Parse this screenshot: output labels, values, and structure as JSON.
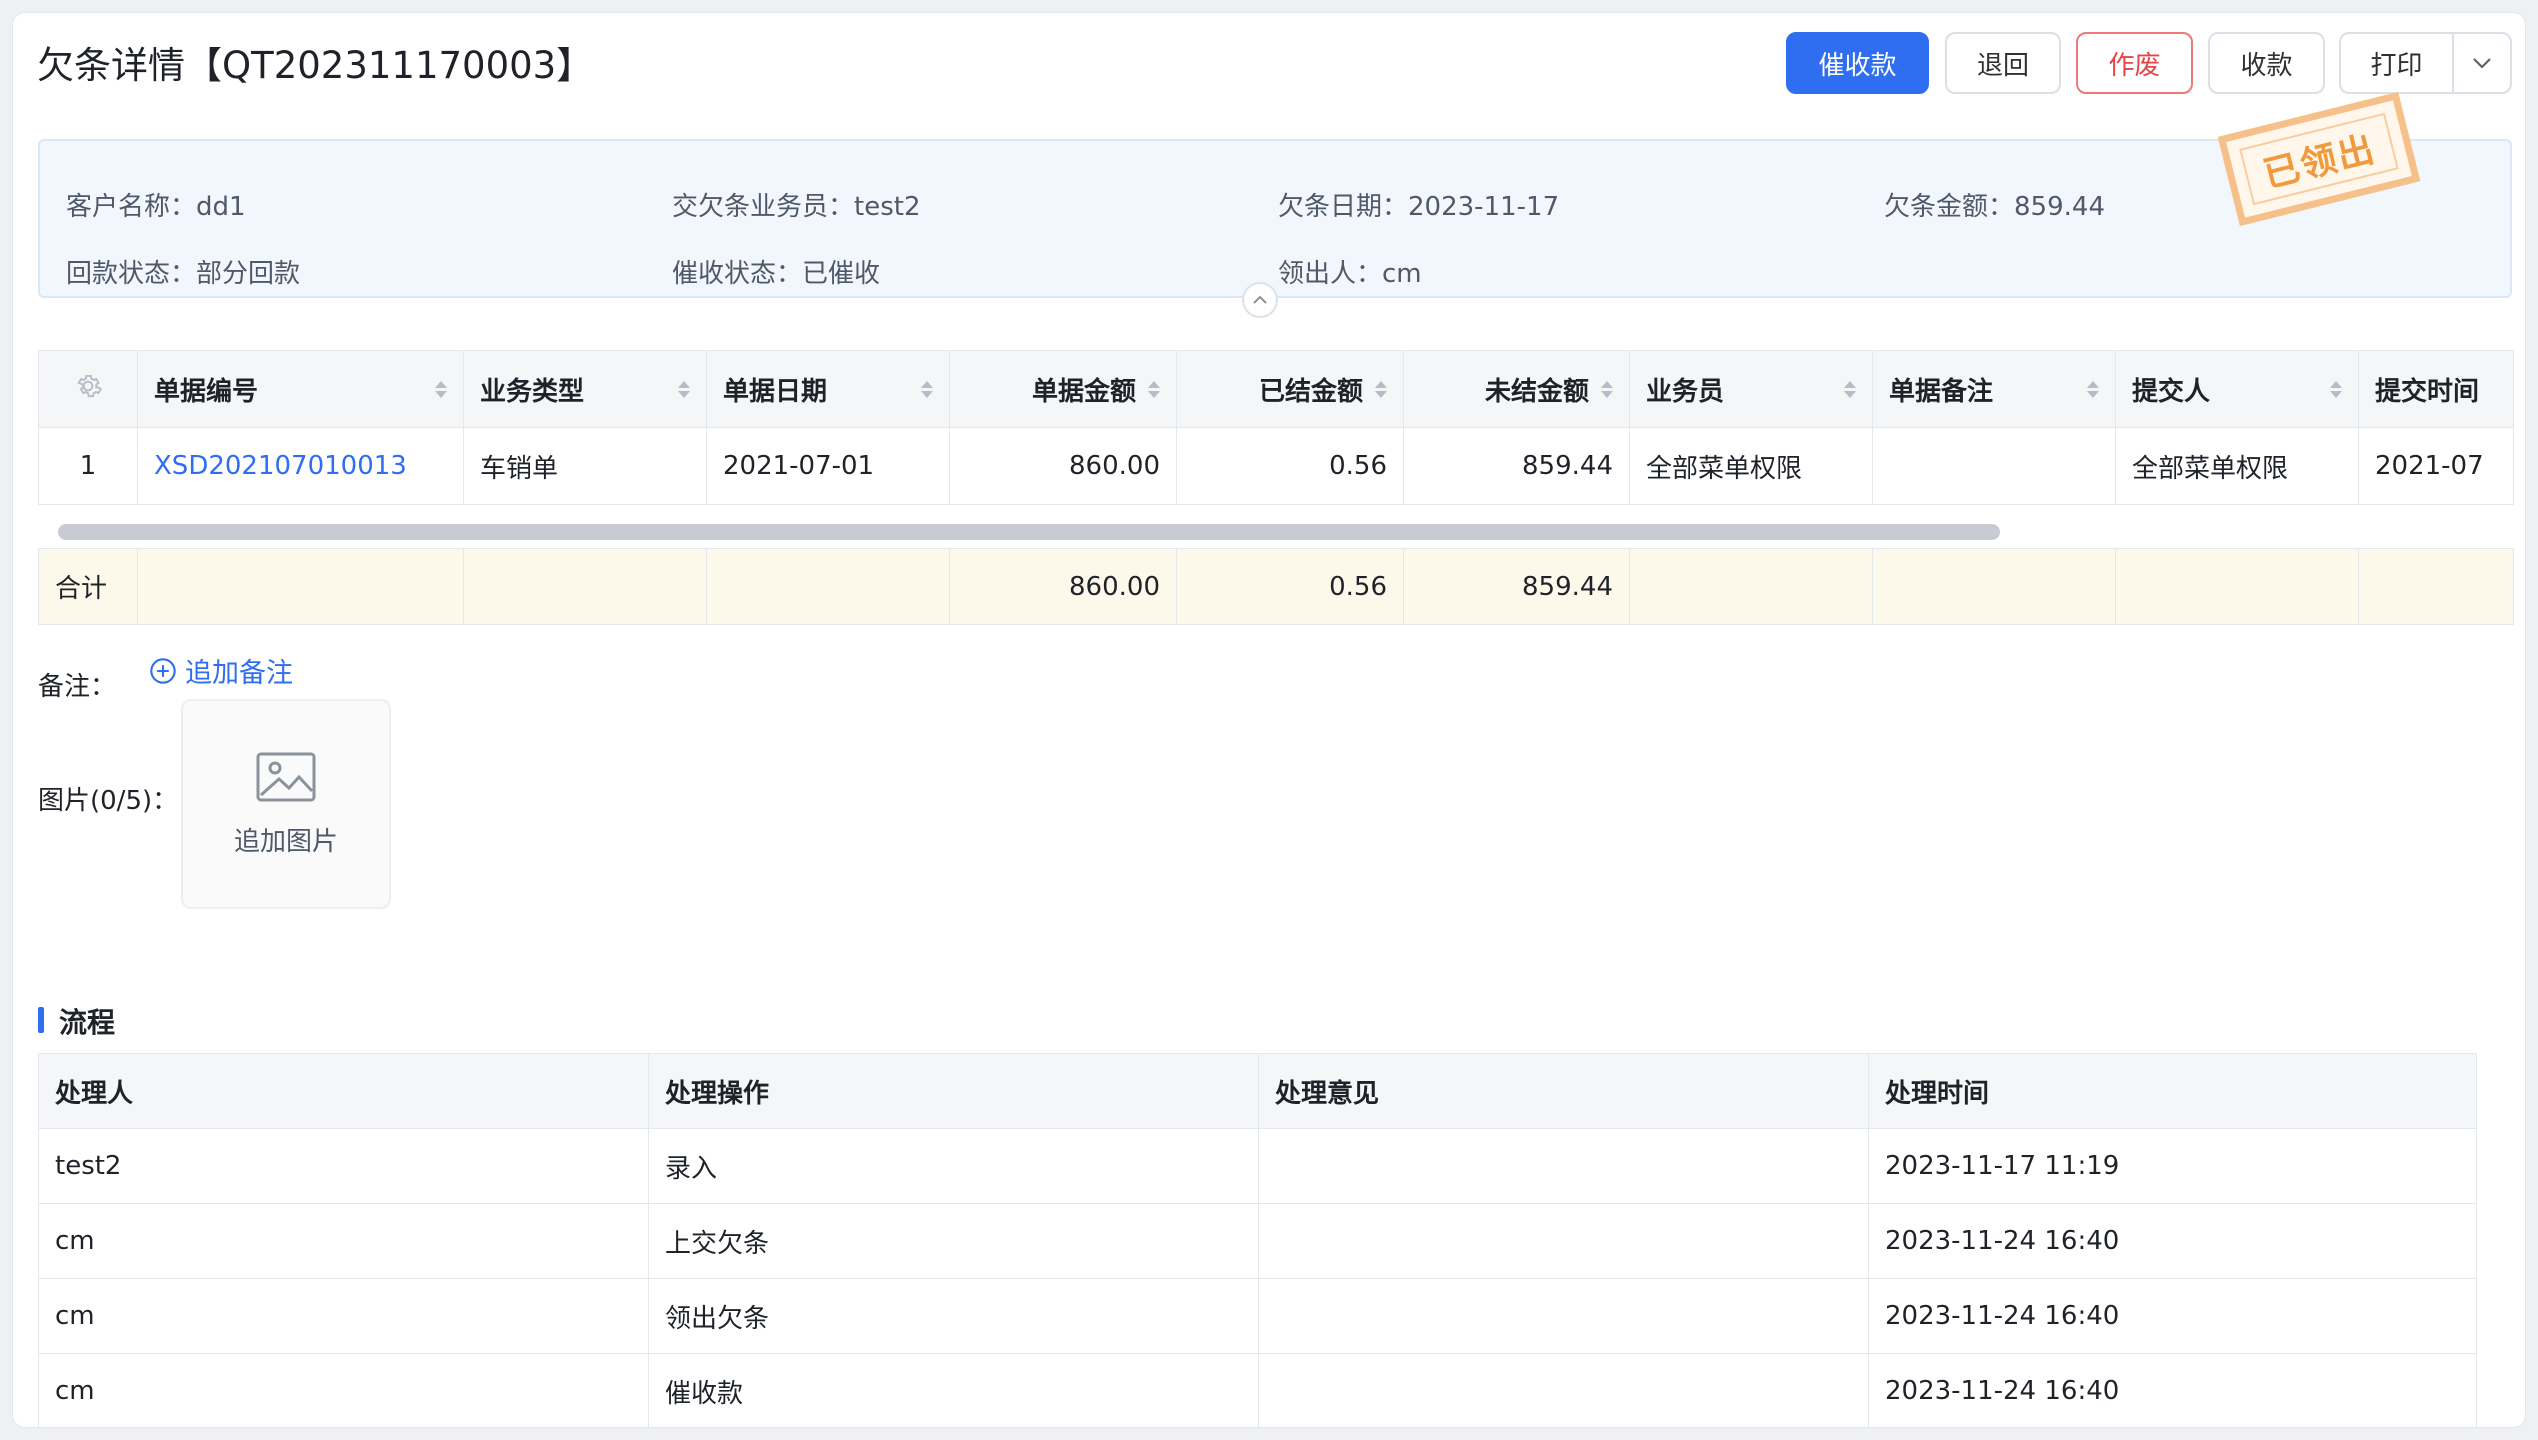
{
  "header": {
    "title": "欠条详情【QT202311170003】",
    "buttons": {
      "urge": "催收款",
      "return": "退回",
      "void": "作废",
      "collect": "收款",
      "print": "打印"
    }
  },
  "info": {
    "customer_label": "客户名称：",
    "customer_value": "dd1",
    "salesman_label": "交欠条业务员：",
    "salesman_value": "test2",
    "date_label": "欠条日期：",
    "date_value": "2023-11-17",
    "amount_label": "欠条金额：",
    "amount_value": "859.44",
    "repay_label": "回款状态：",
    "repay_value": "部分回款",
    "urge_label": "催收状态：",
    "urge_value": "已催收",
    "taker_label": "领出人：",
    "taker_value": "cm",
    "stamp": "已领出"
  },
  "docs_table": {
    "headers": [
      "单据编号",
      "业务类型",
      "单据日期",
      "单据金额",
      "已结金额",
      "未结金额",
      "业务员",
      "单据备注",
      "提交人",
      "提交时间"
    ],
    "rows": [
      [
        "1",
        "XSD202107010013",
        "车销单",
        "2021-07-01",
        "860.00",
        "0.56",
        "859.44",
        "全部菜单权限",
        "",
        "全部菜单权限",
        "2021-07"
      ]
    ],
    "summary": {
      "label": "合计",
      "doc_amount": "860.00",
      "settled": "0.56",
      "unsettled": "859.44"
    }
  },
  "remark": {
    "label": "备注：",
    "add_label": "追加备注"
  },
  "images": {
    "label": "图片(0/5)：",
    "add_label": "追加图片"
  },
  "flow": {
    "title": "流程",
    "headers": [
      "处理人",
      "处理操作",
      "处理意见",
      "处理时间"
    ],
    "rows": [
      [
        "test2",
        "录入",
        "",
        "2023-11-17 11:19"
      ],
      [
        "cm",
        "上交欠条",
        "",
        "2023-11-24 16:40"
      ],
      [
        "cm",
        "领出欠条",
        "",
        "2023-11-24 16:40"
      ],
      [
        "cm",
        "催收款",
        "",
        "2023-11-24 16:40"
      ]
    ]
  }
}
